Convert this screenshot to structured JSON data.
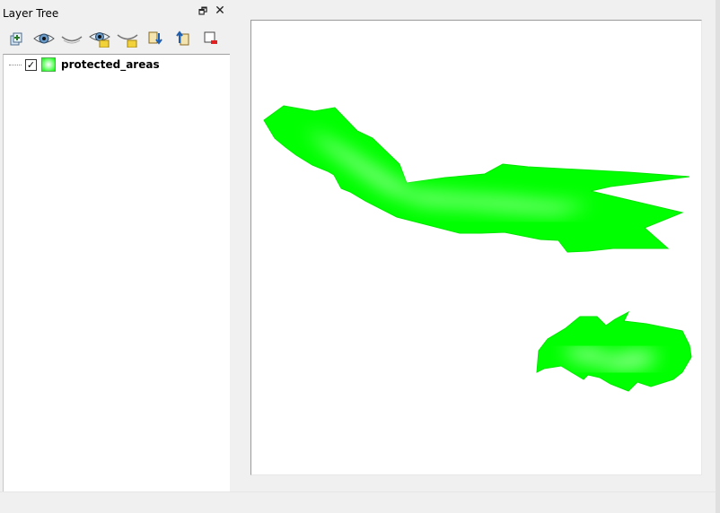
{
  "dock": {
    "title": "Layer Tree",
    "float_glyph": "🗗",
    "close_glyph": "✕",
    "toolbar": [
      {
        "name": "add-group-icon"
      },
      {
        "name": "show-all-layers-icon"
      },
      {
        "name": "hide-all-layers-icon"
      },
      {
        "name": "show-selected-layers-icon"
      },
      {
        "name": "hide-selected-layers-icon"
      },
      {
        "name": "expand-all-icon"
      },
      {
        "name": "collapse-all-icon"
      },
      {
        "name": "remove-layer-icon"
      }
    ]
  },
  "layers": [
    {
      "name": "protected_areas",
      "checked": true,
      "check_glyph": "✓",
      "fill_color": "#00ff00"
    }
  ],
  "map": {
    "background": "#ffffff",
    "feature_fill": "#00ff00",
    "feature_center": "#ffffff"
  }
}
